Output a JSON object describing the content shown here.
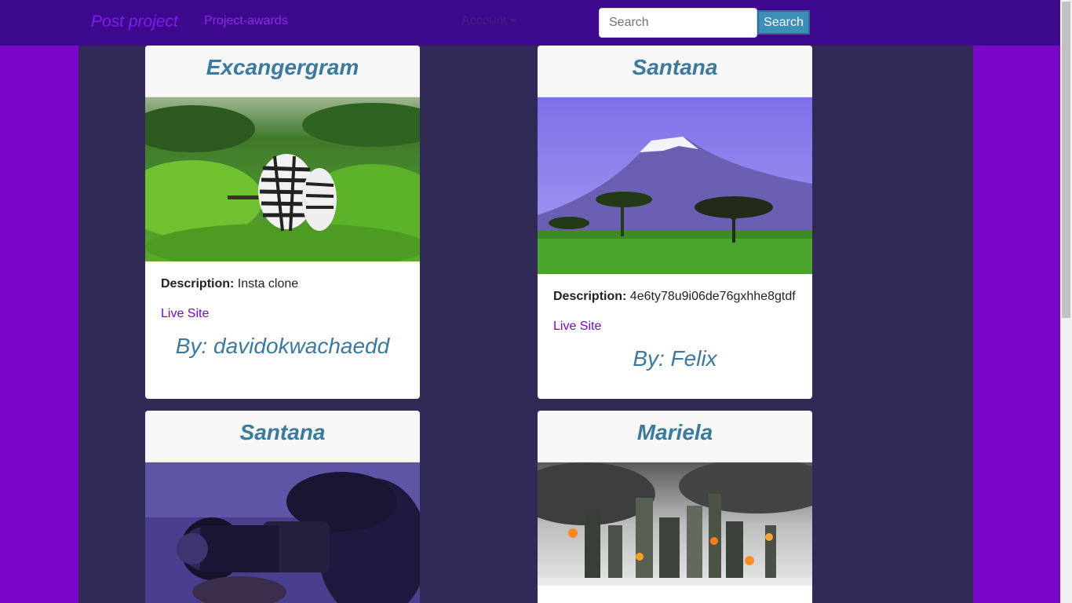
{
  "nav": {
    "brand": "Post project",
    "link": "Project-awards",
    "account": "Account",
    "search_placeholder": "Search",
    "search_button": "Search"
  },
  "projects": [
    {
      "title": "Excangergram",
      "description_label": "Description:",
      "description": "Insta clone",
      "live_label": "Live Site",
      "by": "By: davidokwachaedd"
    },
    {
      "title": "Santana",
      "description_label": "Description:",
      "description": "4e6ty78u9i06de76gxhhe8gtdf",
      "live_label": "Live Site",
      "by": "By: Felix"
    },
    {
      "title": "Santana"
    },
    {
      "title": "Mariela"
    }
  ]
}
